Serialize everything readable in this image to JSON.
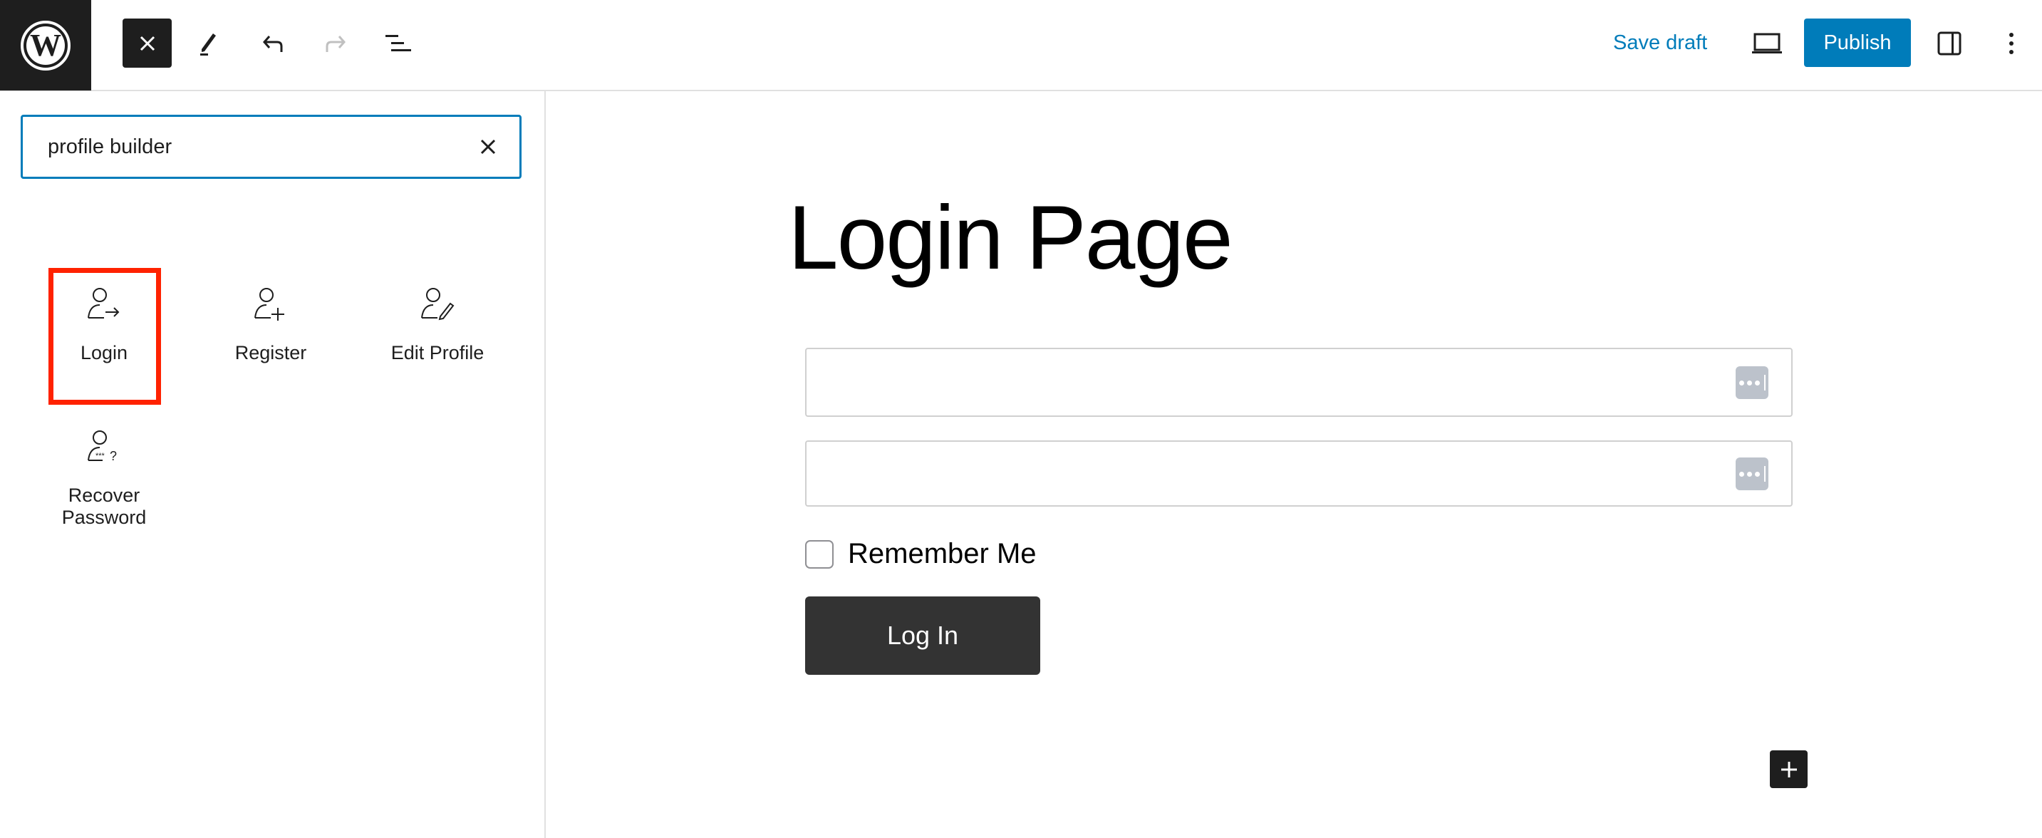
{
  "header": {
    "logo": "wordpress-logo",
    "toolbar": [
      {
        "name": "close-inserter",
        "icon": "close-icon",
        "active": true
      },
      {
        "name": "tools",
        "icon": "pencil-icon"
      },
      {
        "name": "undo",
        "icon": "undo-icon"
      },
      {
        "name": "redo",
        "icon": "redo-icon",
        "disabled": true
      },
      {
        "name": "document-overview",
        "icon": "list-view-icon"
      }
    ],
    "save_draft_label": "Save draft",
    "preview_icon": "laptop-icon",
    "publish_label": "Publish",
    "settings_icon": "sidebar-toggle-icon",
    "options_icon": "kebab-menu-icon"
  },
  "inserter": {
    "search": {
      "value": "profile builder",
      "placeholder": "Search"
    },
    "blocks": [
      {
        "label": "Login",
        "icon": "user-login-icon",
        "highlighted": true
      },
      {
        "label": "Register",
        "icon": "user-add-icon"
      },
      {
        "label": "Edit Profile",
        "icon": "user-edit-icon"
      },
      {
        "label": "Recover Password",
        "label_line1": "Recover",
        "label_line2": "Password",
        "icon": "user-password-icon"
      }
    ]
  },
  "canvas": {
    "page_title": "Login Page",
    "form": {
      "username_value": "",
      "password_value": "",
      "remember_label": "Remember Me",
      "remember_checked": false,
      "submit_label": "Log In"
    },
    "add_block_icon": "plus-icon"
  },
  "colors": {
    "accent": "#007cba",
    "dark": "#1e1e1e",
    "highlight": "#ff2200",
    "button": "#333333"
  }
}
